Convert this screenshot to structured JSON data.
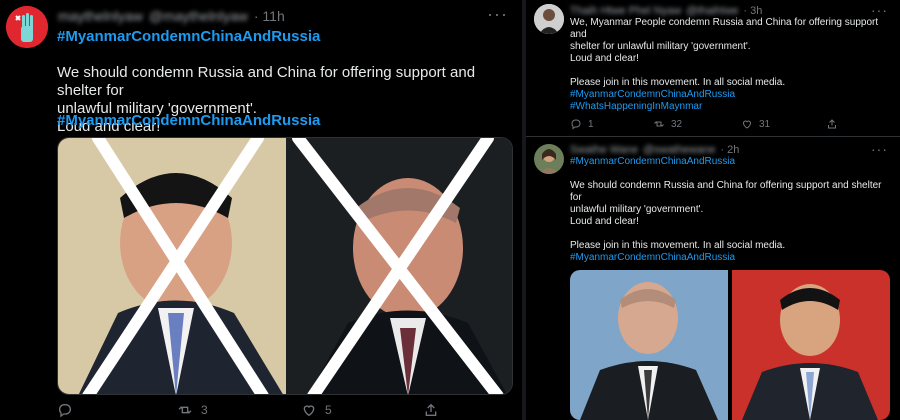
{
  "left_tweet": {
    "user_name_blurred": "maythelnlyaw",
    "user_handle_blurred": "@maythelnlyaw",
    "time": "· 11h",
    "more": "···",
    "hashtag_top": "#MyanmarCondemnChinaAndRussia",
    "body": "We should condemn Russia and China for offering support and shelter for\nunlawful military 'government'.\nLoud and clear!",
    "hashtag_bottom": "#MyanmarCondemnChinaAndRussia",
    "actions": {
      "replies": "",
      "retweets": "3",
      "likes": "5"
    },
    "icons": [
      "reply-icon",
      "retweet-icon",
      "like-icon",
      "share-icon"
    ]
  },
  "right_top_tweet": {
    "user_name_blurred": "Thaih Htwe Phel Nyaw",
    "user_handle_blurred": "@thaihtwe",
    "time": "· 3h",
    "more": "···",
    "body": "We, Myanmar People condemn Russia and China for offering support and\nshelter for unlawful military 'government'.\nLoud and clear!\n\nPlease join in this movement. In all social media.",
    "hashtag1": "#MyanmarCondemnChinaAndRussia",
    "hashtag2": "#WhatsHappeningInMaynmar",
    "actions": {
      "replies": "1",
      "retweets": "32",
      "likes": "31"
    }
  },
  "right_bottom_tweet": {
    "user_name_blurred": "Swathe Wane",
    "user_handle_blurred": "@swathewane",
    "time": "· 2h",
    "more": "···",
    "hashtag_top": "#MyanmarCondemnChinaAndRussia",
    "body": "We should condemn Russia and China for offering support and shelter for\nunlawful military 'government'.\nLoud and clear!\n\nPlease join in this movement. In all social media.",
    "hashtag_bottom": "#MyanmarCondemnChinaAndRussia"
  },
  "colors": {
    "hashtag": "#1d9bf0",
    "background": "#000000",
    "muted": "#71767b",
    "avatar_red": "#e0262f"
  }
}
